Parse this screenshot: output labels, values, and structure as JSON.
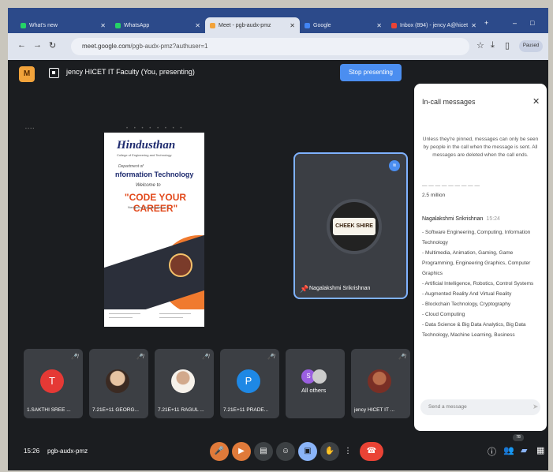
{
  "browser": {
    "tabs": [
      {
        "label": "What's new",
        "fav": "#25d366"
      },
      {
        "label": "WhatsApp",
        "fav": "#25d366"
      },
      {
        "label": "Meet - pgb-audx-pmz",
        "fav": "#f2a33b"
      },
      {
        "label": "Google",
        "fav": "#4285f4"
      },
      {
        "label": "Inbox (894) - jency A@hicet",
        "fav": "#ea4335"
      }
    ],
    "new_tab": "+",
    "url_host": "meet.google.com",
    "url_path": "/pgb-audx-pmz?authuser=1",
    "profile": "Paused"
  },
  "meet": {
    "presenting_label": "jency HICET IT Faculty (You, presenting)",
    "stop_presenting": "Stop presenting",
    "spotlight_name": "Nagalakshmi Srikrishnan",
    "spotlight_logo_text": "CHEEK SHIRE",
    "raise_badge": "1",
    "participants": [
      {
        "name": "1.SAKTHI SREE ...",
        "initial": "T",
        "color": "#e53935",
        "photo": ""
      },
      {
        "name": "7.21E+11 GEORG...",
        "initial": "",
        "color": "",
        "photo": "photo1"
      },
      {
        "name": "7.21E+11 RAGUL ...",
        "initial": "",
        "color": "",
        "photo": "photo2"
      },
      {
        "name": "7.21E+11 PRADE...",
        "initial": "P",
        "color": "#1e88e5",
        "photo": ""
      },
      {
        "name": "All others",
        "initial": "",
        "color": "",
        "photo": ""
      },
      {
        "name": "jency HICET IT ...",
        "initial": "",
        "color": "",
        "photo": "photo3"
      }
    ],
    "others_initial": "S",
    "time": "15:26",
    "meeting_code": "pgb-audx-pmz",
    "people_badge": "78"
  },
  "poster": {
    "brand": "Hindusthan",
    "brand_sub": "College of Engineering and Technology",
    "dept_line1": "Department of",
    "dept_line2": "nformation Technology",
    "welcome": "Welcome to",
    "event": "\"CODE YOUR CAREER\"",
    "tagline": "Navigating Opportunities in IT"
  },
  "chat": {
    "title": "In-call messages",
    "notice": "Unless they're pinned, messages can only be seen by people in the call when the message is sent. All messages are deleted when the call ends.",
    "prev_partial": "2.5 million",
    "sender": "Nagalakshmi Srikrishnan",
    "sender_time": "15:24",
    "lines": [
      "- Software Engineering, Computing, Information Technology",
      "- Multimedia, Animation, Gaming, Game Programming, Engineering Graphics, Computer Graphics",
      "- Artificial Intelligence, Robotics, Control Systems",
      "- Augmented Reality And Virtual Reality",
      "- Blockchain Technology, Cryptography",
      "- Cloud Computing",
      "- Data Science & Big Data Analytics, Big Data Technology, Machine Learning, Business"
    ],
    "input_placeholder": "Send a message"
  }
}
